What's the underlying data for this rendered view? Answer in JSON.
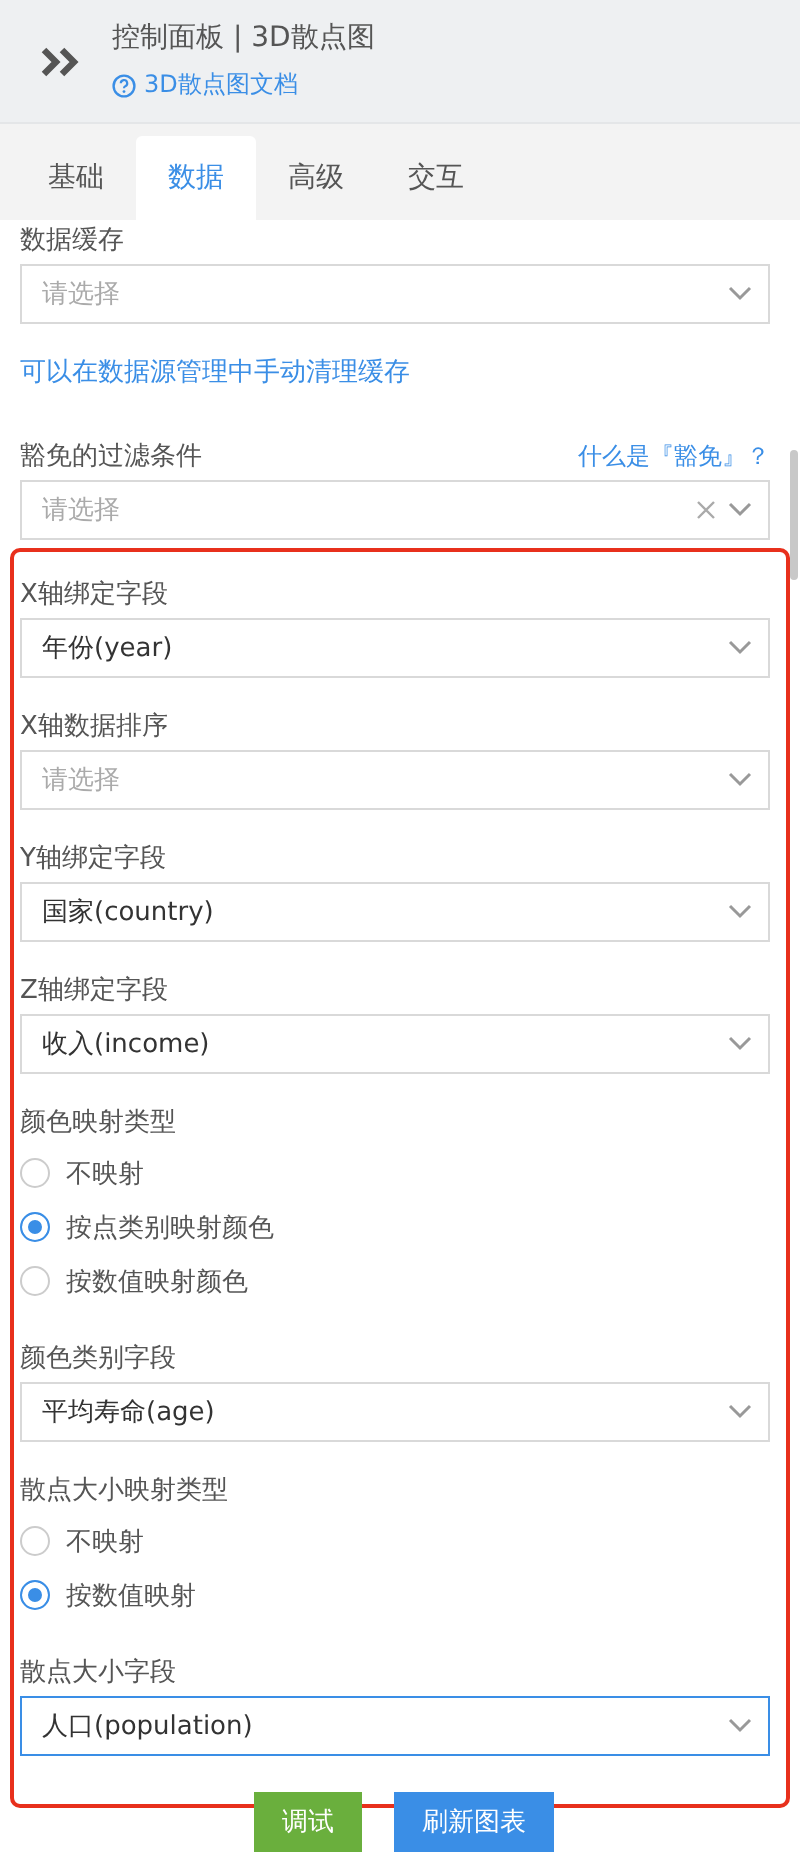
{
  "header": {
    "title": "控制面板 | 3D散点图",
    "doc_link": "3D散点图文档"
  },
  "tabs": [
    {
      "label": "基础",
      "selected": false
    },
    {
      "label": "数据",
      "selected": true
    },
    {
      "label": "高级",
      "selected": false
    },
    {
      "label": "交互",
      "selected": false
    }
  ],
  "fields": [
    {
      "kind": "select",
      "label": "数据缓存",
      "placeholder": "请选择"
    },
    {
      "kind": "link",
      "text": "可以在数据源管理中手动清理缓存"
    },
    {
      "kind": "select",
      "label": "豁免的过滤条件",
      "help": "什么是『豁免』？",
      "placeholder": "请选择",
      "clearable": true
    }
  ],
  "highlighted_fields": [
    {
      "kind": "select",
      "label": "X轴绑定字段",
      "value": "年份(year)"
    },
    {
      "kind": "select",
      "label": "X轴数据排序",
      "placeholder": "请选择"
    },
    {
      "kind": "select",
      "label": "Y轴绑定字段",
      "value": "国家(country)"
    },
    {
      "kind": "select",
      "label": "Z轴绑定字段",
      "value": "收入(income)"
    },
    {
      "kind": "radio",
      "label": "颜色映射类型",
      "options": [
        {
          "label": "不映射",
          "selected": false
        },
        {
          "label": "按点类别映射颜色",
          "selected": true
        },
        {
          "label": "按数值映射颜色",
          "selected": false
        }
      ]
    },
    {
      "kind": "select",
      "label": "颜色类别字段",
      "value": "平均寿命(age)"
    },
    {
      "kind": "radio",
      "label": "散点大小映射类型",
      "options": [
        {
          "label": "不映射",
          "selected": false
        },
        {
          "label": "按数值映射",
          "selected": true
        }
      ]
    },
    {
      "kind": "select",
      "label": "散点大小字段",
      "value": "人口(population)",
      "focused": true
    }
  ],
  "buttons": [
    {
      "label": "调试",
      "kind": "debug"
    },
    {
      "label": "刷新图表",
      "kind": "primary"
    }
  ]
}
